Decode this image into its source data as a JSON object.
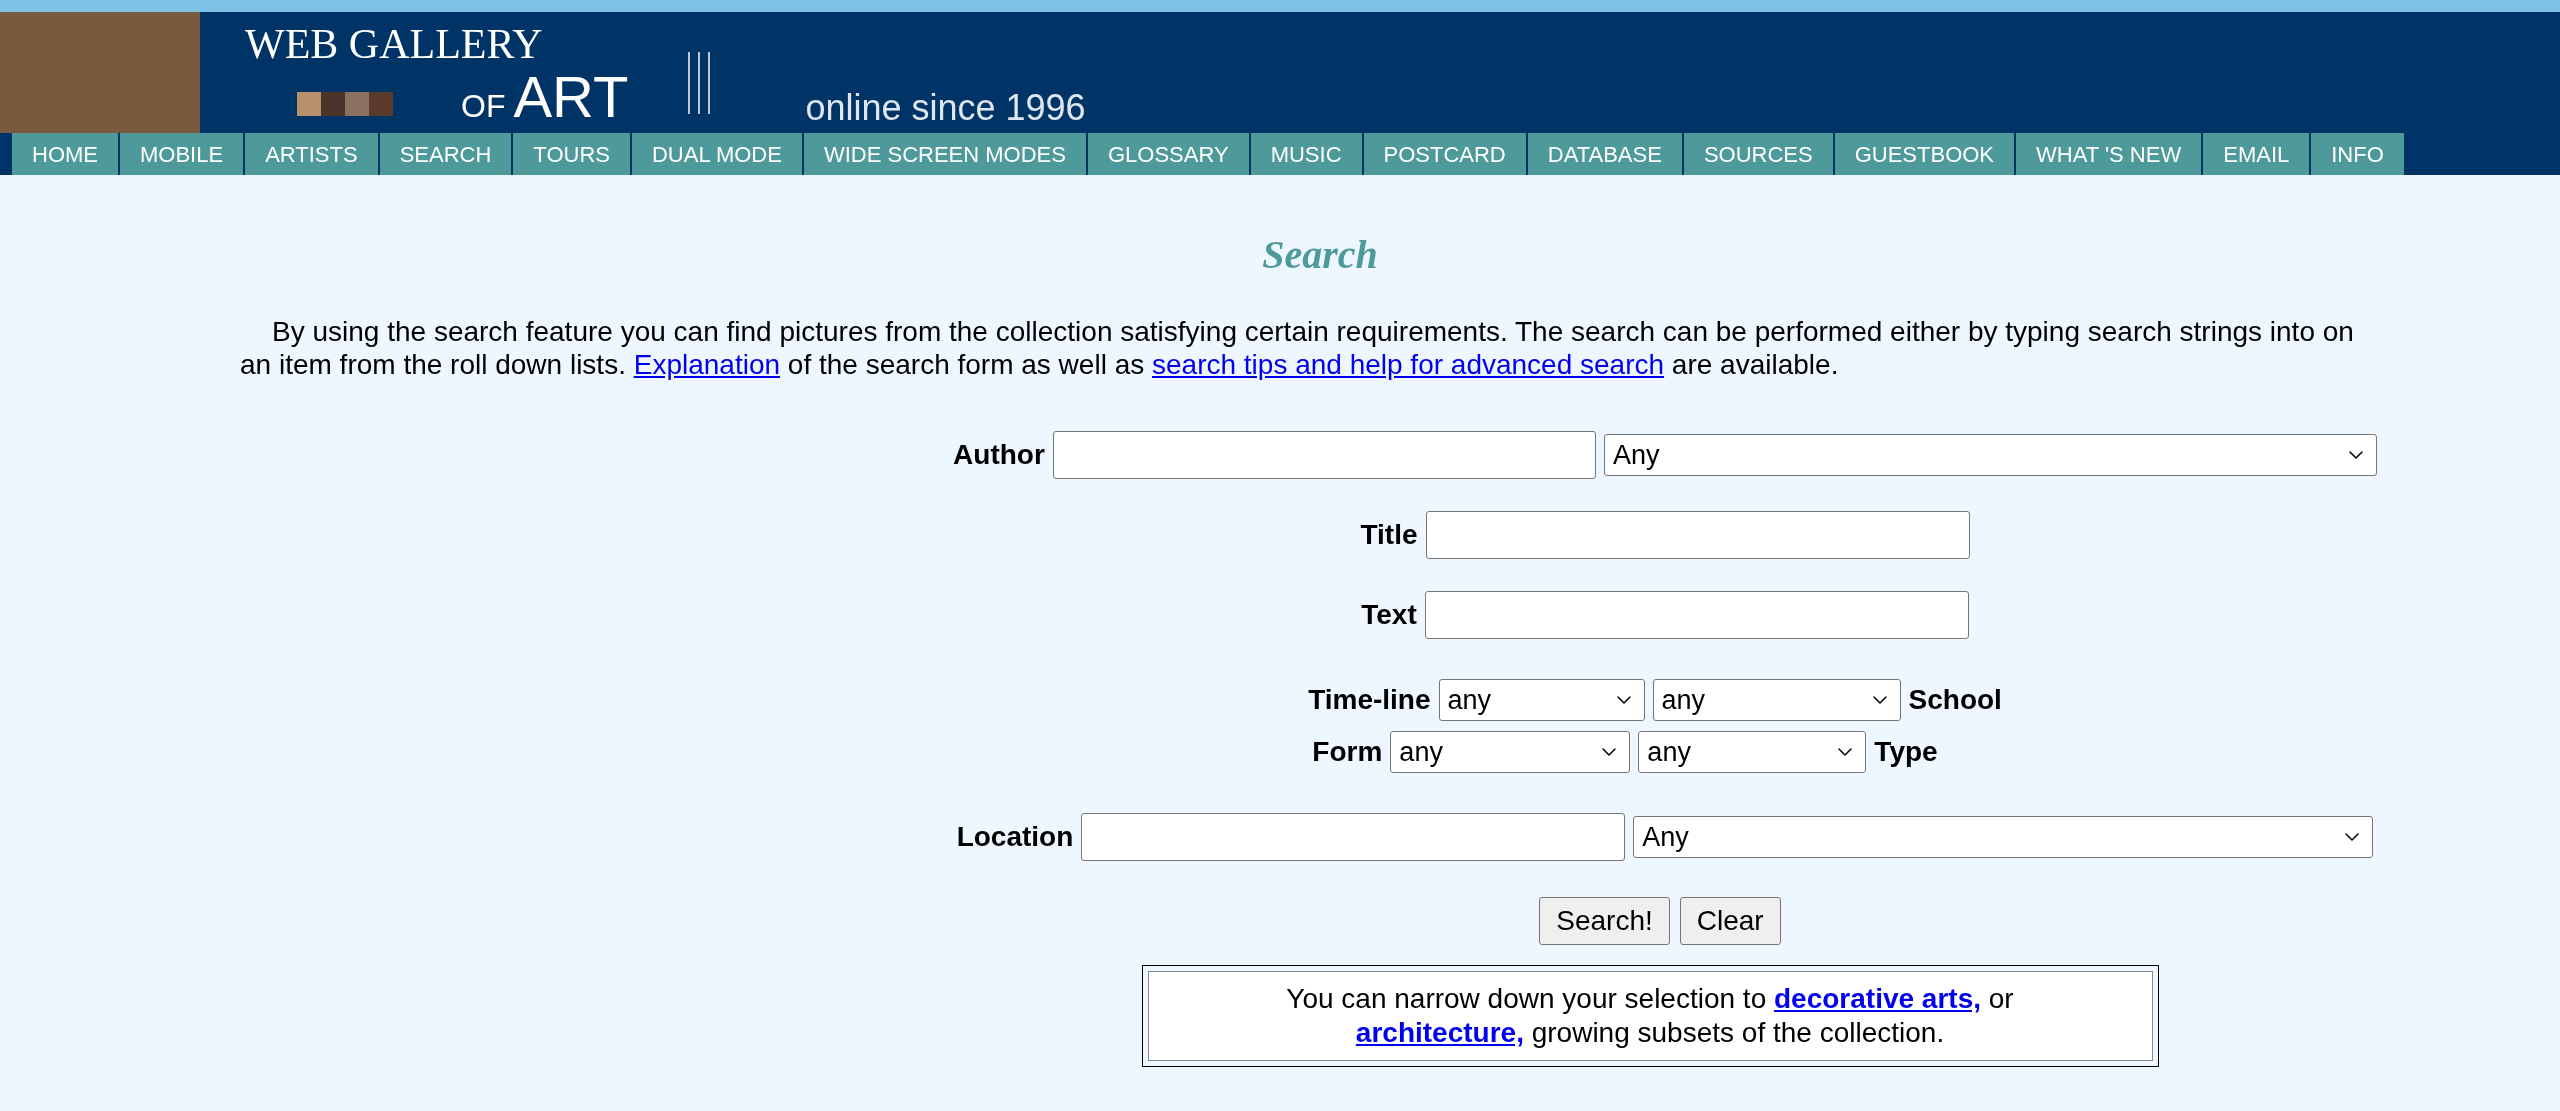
{
  "header": {
    "title_line1": "WEB GALLERY",
    "title_of": "OF",
    "title_art": "ART",
    "tagline": "online since 1996"
  },
  "nav": [
    "HOME",
    "MOBILE",
    "ARTISTS",
    "SEARCH",
    "TOURS",
    "DUAL MODE",
    "WIDE SCREEN MODES",
    "GLOSSARY",
    "MUSIC",
    "POSTCARD",
    "DATABASE",
    "SOURCES",
    "GUESTBOOK",
    "WHAT 'S NEW",
    "EMAIL",
    "INFO"
  ],
  "page_title": "Search",
  "intro": {
    "line1": "By using the search feature you can find pictures from the collection satisfying certain requirements. The search can be performed either by typing search strings into on",
    "line2_start": "an item from the roll down lists.",
    "link1": "Explanation",
    "middle": "of the search form as well as",
    "link2": "search tips and help for advanced search",
    "end": "are available."
  },
  "form": {
    "author": {
      "label": "Author",
      "select": "Any"
    },
    "title": {
      "label": "Title"
    },
    "text": {
      "label": "Text"
    },
    "timeline": {
      "label": "Time-line",
      "select1": "any",
      "select2": "any",
      "label2": "School"
    },
    "form_row": {
      "label": "Form",
      "select1": "any",
      "select2": "any",
      "label2": "Type"
    },
    "location": {
      "label": "Location",
      "select": "Any"
    },
    "buttons": [
      "Search!",
      "Clear"
    ]
  },
  "note": {
    "start": "You can narrow down your selection to",
    "link1": "decorative arts,",
    "mid": "or",
    "link2": "architecture,",
    "end": "growing subsets of the collection."
  }
}
